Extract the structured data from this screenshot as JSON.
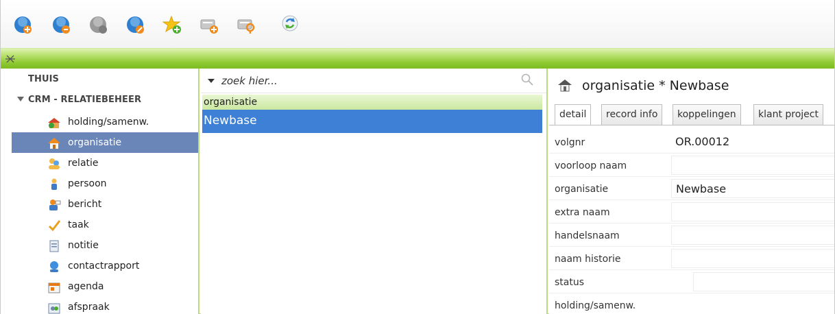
{
  "toolbar": {
    "buttons": [
      {
        "name": "new-record-icon"
      },
      {
        "name": "refresh-records-icon"
      },
      {
        "name": "disabled-globe-icon"
      },
      {
        "name": "edit-record-icon"
      },
      {
        "name": "add-favorite-icon"
      },
      {
        "name": "add-document-icon"
      },
      {
        "name": "search-document-icon"
      },
      {
        "name": "sync-icon"
      }
    ]
  },
  "nav": {
    "thuis": "THUIS",
    "section": "CRM - RELATIEBEHEER",
    "items": [
      {
        "label": "holding/samenw.",
        "icon": "holding-icon"
      },
      {
        "label": "organisatie",
        "icon": "house-icon"
      },
      {
        "label": "relatie",
        "icon": "relation-icon"
      },
      {
        "label": "persoon",
        "icon": "person-icon"
      },
      {
        "label": "bericht",
        "icon": "message-icon"
      },
      {
        "label": "taak",
        "icon": "task-icon"
      },
      {
        "label": "notitie",
        "icon": "note-icon"
      },
      {
        "label": "contactrapport",
        "icon": "contact-report-icon"
      },
      {
        "label": "agenda",
        "icon": "agenda-icon"
      },
      {
        "label": "afspraak",
        "icon": "appointment-icon"
      }
    ]
  },
  "list": {
    "search_placeholder": "zoek hier...",
    "group": "organisatie",
    "rows": [
      "Newbase"
    ]
  },
  "detail": {
    "title": "organisatie * Newbase",
    "tabs": [
      "detail",
      "record info",
      "koppelingen",
      "klant project"
    ],
    "fields": [
      {
        "label": "volgnr",
        "value": "OR.00012"
      },
      {
        "label": "voorloop naam",
        "value": ""
      },
      {
        "label": "organisatie",
        "value": "Newbase"
      },
      {
        "label": "extra naam",
        "value": ""
      },
      {
        "label": "handelsnaam",
        "value": ""
      },
      {
        "label": "naam historie",
        "value": ""
      },
      {
        "label": "status",
        "value": ""
      },
      {
        "label": "holding/samenw.",
        "value": ""
      }
    ]
  },
  "colors": {
    "accent_green": "#8fca33",
    "nav_active": "#6a86b9",
    "row_selected": "#3d80d6"
  }
}
